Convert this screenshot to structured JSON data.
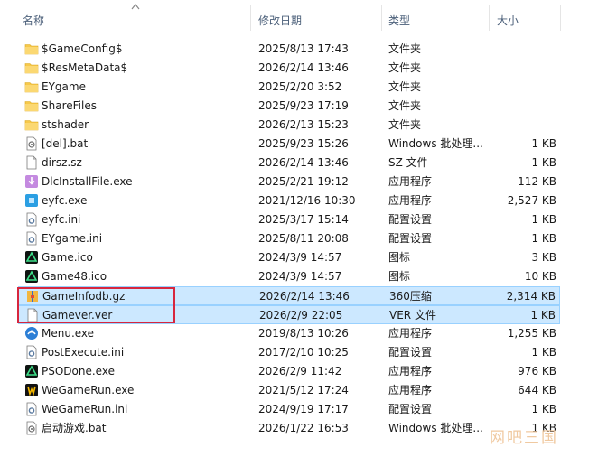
{
  "columns": {
    "name": "名称",
    "date": "修改日期",
    "type": "类型",
    "size": "大小"
  },
  "files": [
    {
      "name": "$GameConfig$",
      "date": "2025/8/13 17:43",
      "type": "文件夹",
      "size": "",
      "icon": "folder-icon"
    },
    {
      "name": "$ResMetaData$",
      "date": "2026/2/14 13:46",
      "type": "文件夹",
      "size": "",
      "icon": "folder-icon"
    },
    {
      "name": "EYgame",
      "date": "2025/2/20 3:52",
      "type": "文件夹",
      "size": "",
      "icon": "folder-icon"
    },
    {
      "name": "ShareFiles",
      "date": "2025/9/23 17:19",
      "type": "文件夹",
      "size": "",
      "icon": "folder-icon"
    },
    {
      "name": "stshader",
      "date": "2026/2/13 15:23",
      "type": "文件夹",
      "size": "",
      "icon": "folder-icon"
    },
    {
      "name": "[del].bat",
      "date": "2025/9/23 15:26",
      "type": "Windows 批处理...",
      "size": "1 KB",
      "icon": "batch-file-icon"
    },
    {
      "name": "dirsz.sz",
      "date": "2026/2/14 13:46",
      "type": "SZ 文件",
      "size": "1 KB",
      "icon": "document-icon"
    },
    {
      "name": "DlcInstallFile.exe",
      "date": "2025/2/21 19:12",
      "type": "应用程序",
      "size": "112 KB",
      "icon": "installer-icon"
    },
    {
      "name": "eyfc.exe",
      "date": "2021/12/16 10:30",
      "type": "应用程序",
      "size": "2,527 KB",
      "icon": "eyfc-app-icon"
    },
    {
      "name": "eyfc.ini",
      "date": "2025/3/17 15:14",
      "type": "配置设置",
      "size": "1 KB",
      "icon": "settings-file-icon"
    },
    {
      "name": "EYgame.ini",
      "date": "2025/8/11 20:08",
      "type": "配置设置",
      "size": "1 KB",
      "icon": "settings-file-icon"
    },
    {
      "name": "Game.ico",
      "date": "2024/3/9 14:57",
      "type": "图标",
      "size": "3 KB",
      "icon": "game-logo-icon"
    },
    {
      "name": "Game48.ico",
      "date": "2024/3/9 14:57",
      "type": "图标",
      "size": "10 KB",
      "icon": "game-logo-icon"
    },
    {
      "name": "GameInfodb.gz",
      "date": "2026/2/14 13:46",
      "type": "360压缩",
      "size": "2,314 KB",
      "icon": "archive-icon",
      "selected": true
    },
    {
      "name": "Gamever.ver",
      "date": "2026/2/9 22:05",
      "type": "VER 文件",
      "size": "1 KB",
      "icon": "document-icon",
      "selected": true
    },
    {
      "name": "Menu.exe",
      "date": "2019/8/13 10:26",
      "type": "应用程序",
      "size": "1,255 KB",
      "icon": "menu-app-icon"
    },
    {
      "name": "PostExecute.ini",
      "date": "2017/2/10 10:25",
      "type": "配置设置",
      "size": "1 KB",
      "icon": "settings-file-icon"
    },
    {
      "name": "PSODone.exe",
      "date": "2026/2/9 11:42",
      "type": "应用程序",
      "size": "976 KB",
      "icon": "game-logo-icon"
    },
    {
      "name": "WeGameRun.exe",
      "date": "2021/5/12 17:24",
      "type": "应用程序",
      "size": "644 KB",
      "icon": "wegame-icon"
    },
    {
      "name": "WeGameRun.ini",
      "date": "2024/9/19 17:17",
      "type": "配置设置",
      "size": "1 KB",
      "icon": "settings-file-icon"
    },
    {
      "name": "启动游戏.bat",
      "date": "2026/1/22 16:53",
      "type": "Windows 批处理...",
      "size": "1 KB",
      "icon": "batch-file-icon"
    }
  ],
  "watermark": "网吧三国",
  "colors": {
    "selection_bg": "#cce8ff",
    "selection_border": "#99d1ff",
    "highlight_box": "#d7263d",
    "folder": "#f7c94a"
  }
}
